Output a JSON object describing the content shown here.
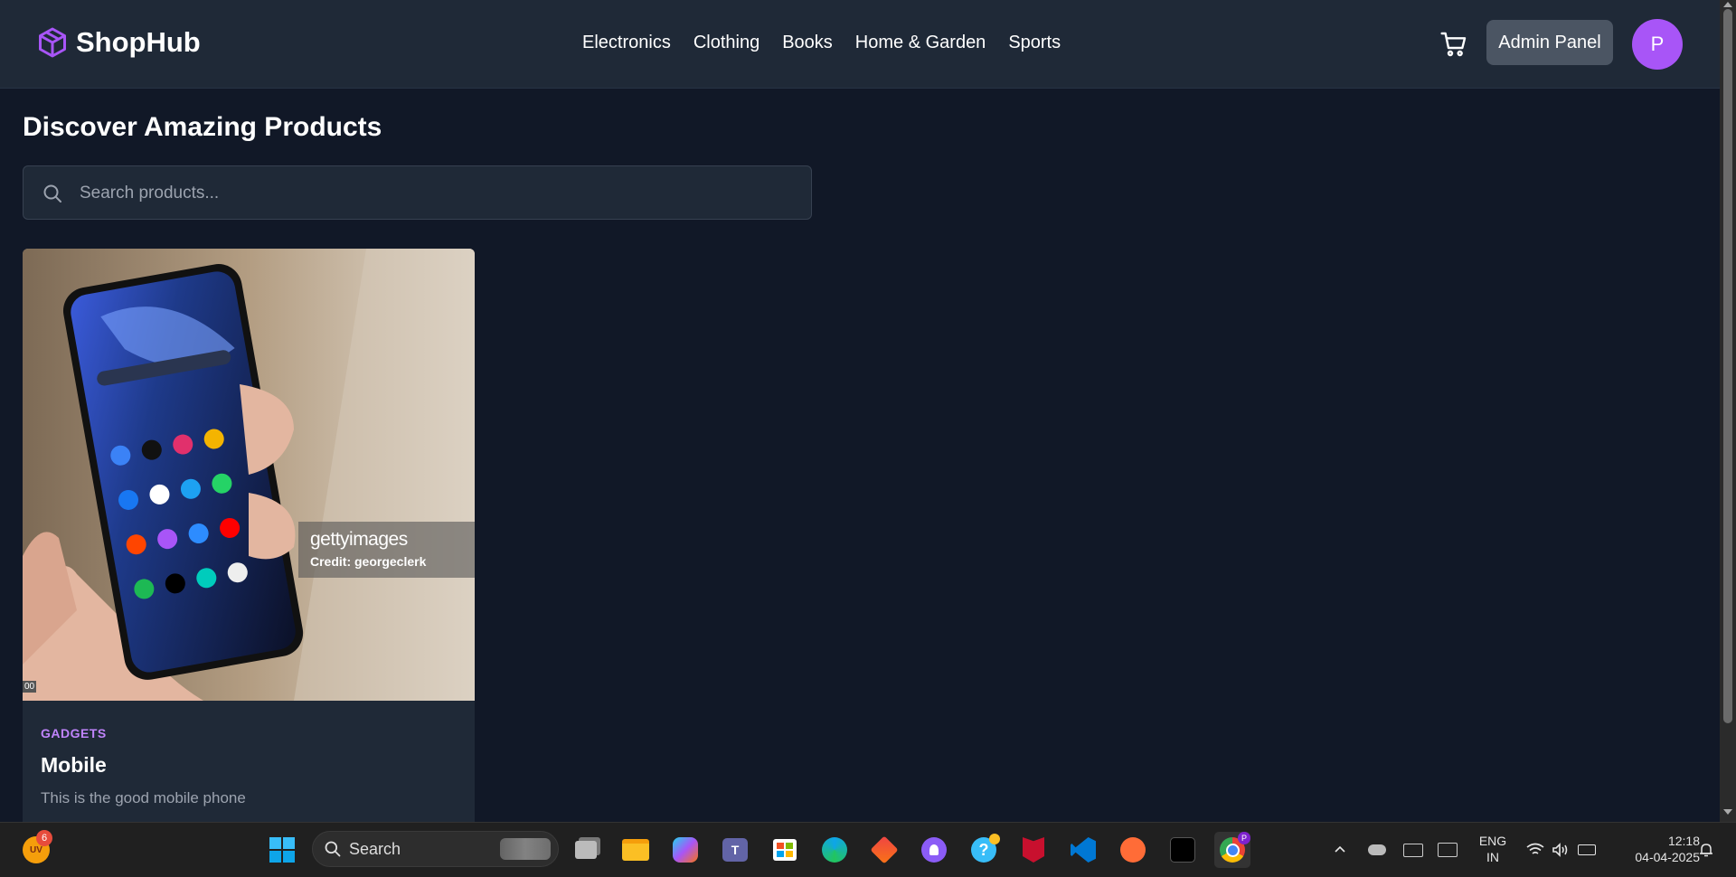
{
  "header": {
    "brand": "ShopHub",
    "nav": [
      "Electronics",
      "Clothing",
      "Books",
      "Home & Garden",
      "Sports"
    ],
    "admin_label": "Admin Panel",
    "avatar_initial": "P",
    "accent_color": "#a855f7"
  },
  "main": {
    "title": "Discover Amazing Products",
    "search_placeholder": "Search products..."
  },
  "products": [
    {
      "category": "GADGETS",
      "name": "Mobile",
      "description": "This is the good mobile phone",
      "image_watermark": "gettyimages",
      "image_credit": "Credit: georgeclerk",
      "image_corner_text": "00"
    }
  ],
  "taskbar": {
    "widget_text": "UV",
    "widget_badge": "6",
    "search_label": "Search",
    "chrome_profile": "P",
    "lang_line1": "ENG",
    "lang_line2": "IN",
    "time": "12:18",
    "date": "04-04-2025"
  }
}
